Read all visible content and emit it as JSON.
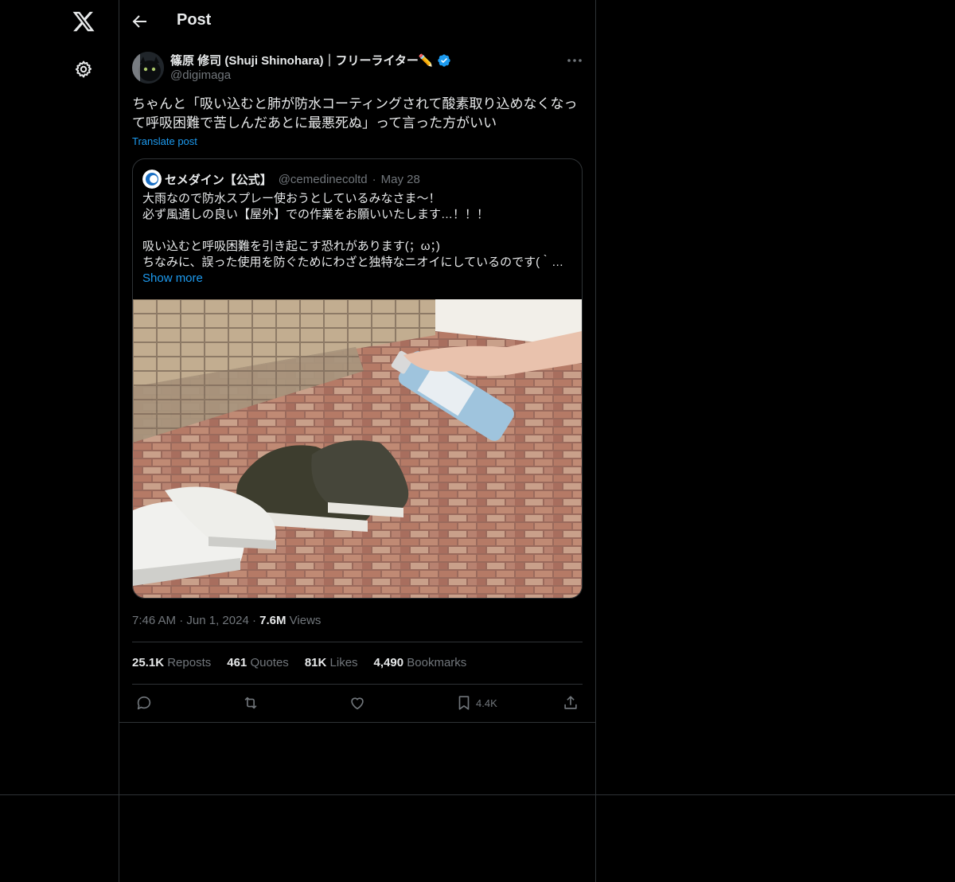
{
  "header": {
    "title": "Post"
  },
  "author": {
    "name": "篠原 修司 (Shuji Shinohara)｜フリーライター✏️",
    "handle": "@digimaga"
  },
  "tweet": {
    "text": "ちゃんと「吸い込むと肺が防水コーティングされて酸素取り込めなくなって呼吸困難で苦しんだあとに最悪死ぬ」って言った方がいい",
    "translate_label": "Translate post"
  },
  "quote": {
    "name": "セメダイン【公式】",
    "handle": "@cemedinecoltd",
    "date": "May 28",
    "lines": [
      "大雨なので防水スプレー使おうとしているみなさま〜！",
      "必ず風通しの良い【屋外】での作業をお願いいたします…！！！",
      "",
      "吸い込むと呼吸困難を引き起こす恐れがあります(；ω；)",
      "ちなみに、誤った使用を防ぐためにわざと独特なニオイにしているのです(｀…"
    ],
    "show_more": "Show more"
  },
  "meta": {
    "time": "7:46 AM",
    "date": "Jun 1, 2024",
    "views_count": "7.6M",
    "views_label": "Views"
  },
  "stats": {
    "reposts_count": "25.1K",
    "reposts_label": "Reposts",
    "quotes_count": "461",
    "quotes_label": "Quotes",
    "likes_count": "81K",
    "likes_label": "Likes",
    "bookmarks_count": "4,490",
    "bookmarks_label": "Bookmarks"
  },
  "actions": {
    "bookmark_count": "4.4K"
  },
  "colors": {
    "accent": "#1d9bf0",
    "border": "#2f3336",
    "muted": "#71767b"
  }
}
